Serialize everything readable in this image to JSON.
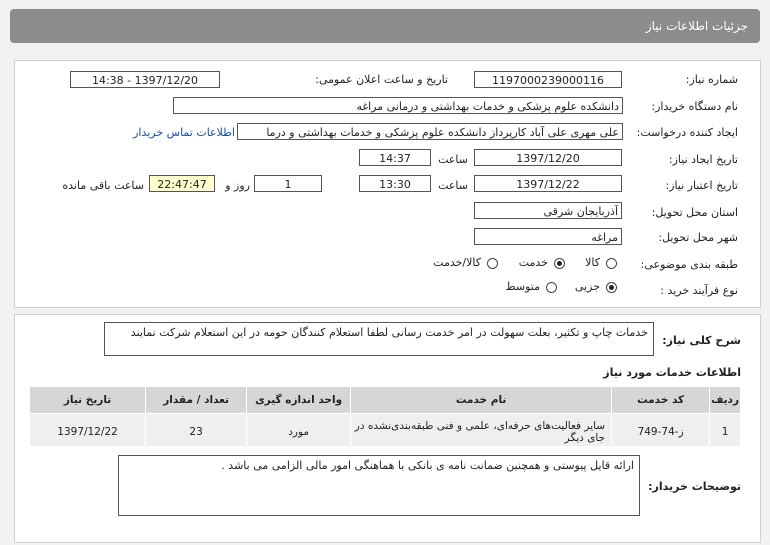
{
  "header": {
    "title": "جزئیات اطلاعات نیاز"
  },
  "form": {
    "need_number_label": "شماره نیاز:",
    "need_number": "1197000239000116",
    "announce_label": "تاریخ و ساعت اعلان عمومی:",
    "announce_value": "1397/12/20 - 14:38",
    "buyer_org_label": "نام دستگاه خریدار:",
    "buyer_org": "دانشکده علوم پزشکی و خدمات بهداشتی و درمانی مراغه",
    "requester_label": "ایجاد کننده درخواست:",
    "requester": "علی  مهری علی آباد کارپرداز دانشکده علوم پزشکی و خدمات بهداشتی و درما",
    "contact_link": "اطلاعات تماس خریدار",
    "created_label": "تاریخ ایجاد نیاز:",
    "created_date": "1397/12/20",
    "time_label": "ساعت",
    "created_time": "14:37",
    "validity_label": "تاریخ اعتبار نیاز:",
    "validity_date": "1397/12/22",
    "validity_time": "13:30",
    "days_value": "1",
    "days_label": "روز و",
    "remaining_time": "22:47:47",
    "remaining_label": "ساعت باقی مانده",
    "province_label": "استان محل تحویل:",
    "province": "آذربایجان شرقی",
    "city_label": "شهر محل تحویل:",
    "city": "مراغه",
    "category_label": "طبقه بندی موضوعی:",
    "category_options": [
      "کالا",
      "خدمت",
      "کالا/خدمت"
    ],
    "category_selected": 1,
    "process_label": "نوع فرآیند خرید :",
    "process_options": [
      "جزیی",
      "متوسط"
    ],
    "process_selected": 0
  },
  "description": {
    "label": "شرح کلی نیاز:",
    "text": "خدمات چاپ و تکثیر، بعلت سهولت در امر خدمت رسانی لطفا استعلام کنندگان حومه در این استعلام شرکت نمایند"
  },
  "services": {
    "title": "اطلاعات خدمات مورد نیاز",
    "columns": [
      "ردیف",
      "کد خدمت",
      "نام خدمت",
      "واحد اندازه گیری",
      "تعداد / مقدار",
      "تاریخ نیاز"
    ],
    "rows": [
      [
        "1",
        "ز-74-749",
        "سایر فعالیت‌های حرفه‌ای، علمی و فنی طبقه‌بندی‌نشده در جای دیگر",
        "مورد",
        "23",
        "1397/12/22"
      ]
    ]
  },
  "buyer_notes": {
    "label": "توضیحات خریدار:",
    "text": "ارائه قایل پیوستی و همچنین ضمانت نامه ی بانکی با هماهنگی امور مالی الزامی می باشد ."
  }
}
